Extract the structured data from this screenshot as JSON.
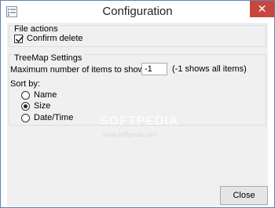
{
  "window": {
    "title": "Configuration",
    "close_glyph": "✕"
  },
  "file_actions": {
    "title": "File actions",
    "confirm_delete_label": "Confirm delete",
    "confirm_delete_checked": true
  },
  "treemap": {
    "title": "TreeMap Settings",
    "max_items_label": "Maximum number of items to show:",
    "max_items_value": "-1",
    "max_items_hint": "(-1 shows all items)",
    "sort_by_label": "Sort by:",
    "sort_options": [
      {
        "label": "Name",
        "checked": false
      },
      {
        "label": "Size",
        "checked": true
      },
      {
        "label": "Date/Time",
        "checked": false
      }
    ]
  },
  "watermark": {
    "text": "SOFTPEDIA",
    "url": "www.softpedia.com"
  },
  "footer": {
    "close_label": "Close"
  },
  "colors": {
    "close_button_bg": "#c7463d",
    "window_border": "#5b84b9"
  }
}
